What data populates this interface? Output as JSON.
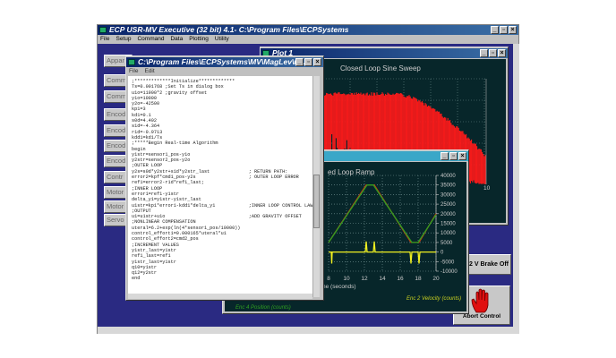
{
  "app": {
    "title": "ECP USR-MV Executive (32 bit) 4.1- C:\\Program Files\\ECPSystems",
    "menu": [
      "File",
      "Setup",
      "Command",
      "Data",
      "Plotting",
      "Utility"
    ]
  },
  "left_buttons": [
    "Appar",
    "Comm",
    "Comm",
    "Encod",
    "Encod",
    "Encod",
    "Encod",
    "Contr",
    "Motor",
    "Motor",
    "Servo"
  ],
  "editor": {
    "title": "C:\\Program Files\\ECPSystems\\MV\\MagLev\\no...",
    "menu": [
      "File",
      "Edit"
    ],
    "code": ";*************Initialize*************\nTs=0.001768 ;Set Ts in dialog box\nu1o=11900*2 ;gravity offset\ny1o=10000\ny2o=-42500\nkp1=3\nkd1=0.1\ns0d=4.402\ns1d=-4.364\nr1d=-0.9713\nkdd1=kd1/Ts\n;*****Begin Real-time Algorithm\nbegin\ny1str=sensor1_pos-y1o\ny2str=sensor2_pos-y2o\n;OUTER LOOP\ny2s=s0d*y2str+s1d*y2str_last              ; RETURN PATH:\nerror2=kpf*cmd1_pos-y2s                   ; OUTER LOOP ERROR\nref1=error2-r1d*ref1_last;\n;INNER LOOP\nerror1=ref1-y1str\ndelta_y1=y1str-y1str_last\nu1str=kp1*error1-kdd1*delta_y1            ;INNER LOOP CONTROL LAW\n;OUTPUT\nu1=u1str+u1o                              ;ADD GRAVITY OFFSET\n;NONLINEAR COMPENSATION\nuteral=6.2+exp(ln(4*sensor1_pos/10000))\ncontrol_effort1=0.000165*uteral*u1\ncontrol_effort2=cmd2_pos\n;INCREMENT VALUES\ny1str_last=y1str\nref1_last=ref1\ny1str_last=y1str\nq10=y1str\nq12=y2str\nend"
  },
  "plot1": {
    "title": "Plot 1",
    "chart_title": "Closed Loop Sine Sweep",
    "x_tick": "10",
    "legend": "Enc 4 Position (counts)",
    "color": "#ff1a1a"
  },
  "plot2": {
    "chart_title": "ed Loop Ramp",
    "xlabel": "ne (seconds)",
    "legend": "Enc 2 Velocity (counts)"
  },
  "chart_data": {
    "type": "line",
    "title": "ed Loop Ramp",
    "xlabel": "ne (seconds)",
    "xlim": [
      8,
      20
    ],
    "ylim": [
      -10000,
      40000
    ],
    "grid": true,
    "x_ticks": [
      "8",
      "10",
      "12",
      "14",
      "16",
      "18",
      "20"
    ],
    "y_ticks": [
      "40000",
      "35000",
      "30000",
      "25000",
      "20000",
      "15000",
      "10000",
      "5000",
      "0",
      "-5000",
      "-10000"
    ],
    "series": [
      {
        "color": "#d03010",
        "x": [
          8,
          12.2,
          13.1,
          17.2,
          18.1,
          20
        ],
        "y": [
          5000,
          35000,
          35000,
          5000,
          5000,
          20000
        ]
      },
      {
        "color": "#30a020",
        "x": [
          8,
          12.3,
          13,
          17.3,
          18,
          20
        ],
        "y": [
          5000,
          35000,
          35000,
          5000,
          5000,
          19500
        ]
      },
      {
        "name": "Enc 2 Velocity (counts)",
        "color": "#f0f020",
        "x": [
          8,
          8.3,
          8.35,
          8.4,
          12.1,
          12.2,
          12.3,
          13,
          13.1,
          13.2,
          17.1,
          17.2,
          17.3,
          18,
          18.1,
          18.2,
          20
        ],
        "y": [
          0,
          0,
          -6000,
          0,
          0,
          5500,
          0,
          0,
          5500,
          0,
          0,
          -6000,
          0,
          0,
          -6000,
          0,
          0
        ]
      }
    ]
  },
  "buttons": {
    "brake": "2 V Brake Off",
    "abort": "Abort Control"
  }
}
